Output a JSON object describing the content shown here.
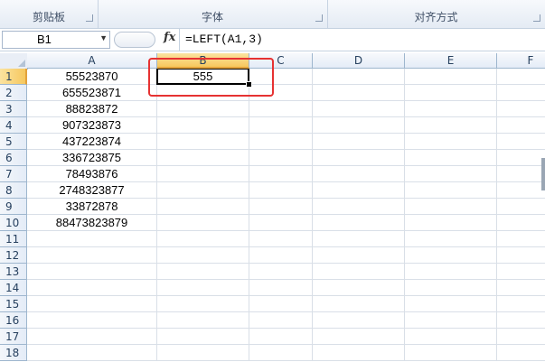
{
  "ribbon": {
    "groups": [
      {
        "label": "剪贴板"
      },
      {
        "label": "字体"
      },
      {
        "label": "对齐方式"
      }
    ]
  },
  "formula_bar": {
    "name_box": "B1",
    "fx_label": "fx",
    "formula": "=LEFT(A1,3)"
  },
  "sheet": {
    "columns": [
      "A",
      "B",
      "C",
      "D",
      "E",
      "F"
    ],
    "rows": [
      "1",
      "2",
      "3",
      "4",
      "5",
      "6",
      "7",
      "8",
      "9",
      "10",
      "11",
      "12",
      "13",
      "14",
      "15",
      "16",
      "17",
      "18"
    ],
    "cells": {
      "A": [
        "55523870",
        "655523871",
        "88823872",
        "907323873",
        "437223874",
        "336723875",
        "78493876",
        "2748323877",
        "33872878",
        "88473823879"
      ],
      "B": [
        "555"
      ]
    },
    "active_cell": "B1",
    "highlight_color": "#e63232"
  }
}
